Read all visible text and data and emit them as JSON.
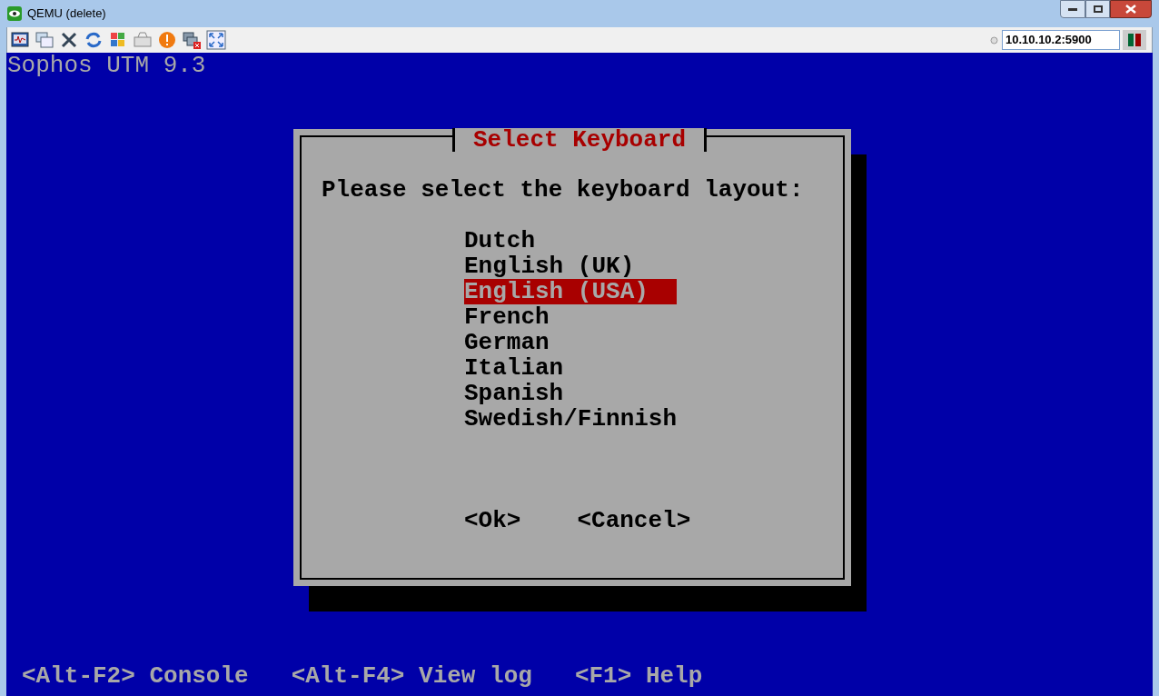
{
  "window": {
    "title": "QEMU (delete)"
  },
  "toolbar": {
    "address": "10.10.10.2:5900"
  },
  "console": {
    "header": "Sophos UTM 9.3",
    "dialog": {
      "title": "Select Keyboard",
      "prompt": "Please select the keyboard layout:",
      "options": [
        {
          "label": "Dutch",
          "selected": false
        },
        {
          "label": "English (UK)",
          "selected": false
        },
        {
          "label": "English (USA)",
          "selected": true
        },
        {
          "label": "French",
          "selected": false
        },
        {
          "label": "German",
          "selected": false
        },
        {
          "label": "Italian",
          "selected": false
        },
        {
          "label": "Spanish",
          "selected": false
        },
        {
          "label": "Swedish/Finnish",
          "selected": false
        }
      ],
      "buttons": [
        "<Ok>",
        "<Cancel>"
      ]
    },
    "footer": [
      "<Alt-F2> Console",
      "<Alt-F4> View log",
      "<F1> Help"
    ]
  }
}
